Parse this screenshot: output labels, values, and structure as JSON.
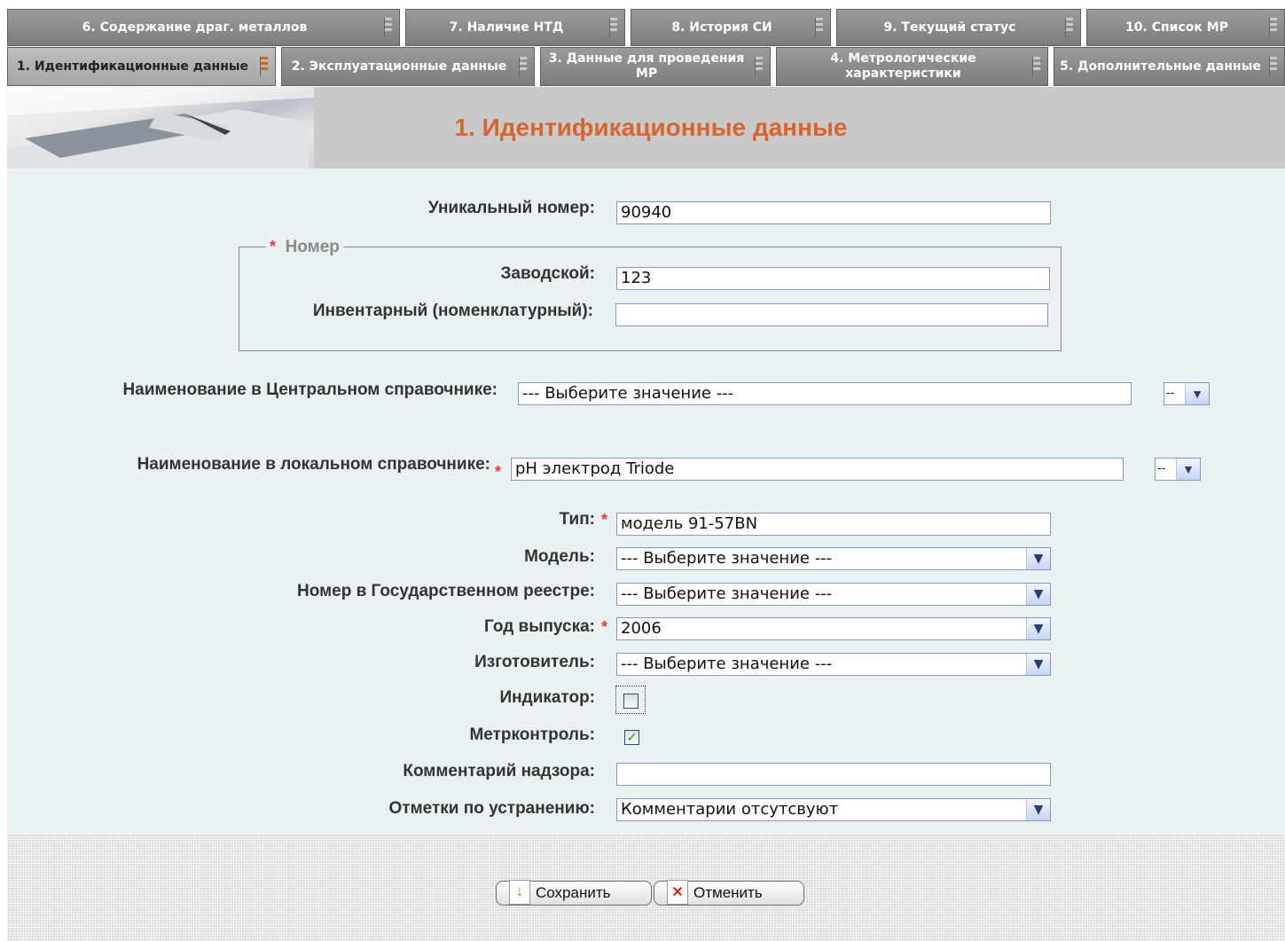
{
  "tabs": {
    "top_row": [
      {
        "label": "6. Содержание драг. металлов"
      },
      {
        "label": "7. Наличие НТД"
      },
      {
        "label": "8. История СИ"
      },
      {
        "label": "9. Текущий статус"
      },
      {
        "label": "10. Список МР"
      }
    ],
    "bottom_row": [
      {
        "label": "1. Идентификационные данные",
        "active": true
      },
      {
        "label": "2. Эксплуатационные данные"
      },
      {
        "label": "3. Данные для проведения МР"
      },
      {
        "label": "4. Метрологические характеристики"
      },
      {
        "label": "5. Дополнительные данные"
      }
    ]
  },
  "header": {
    "title": "1. Идентификационные данные"
  },
  "form": {
    "unique_number": {
      "label": "Уникальный номер:",
      "value": "90940"
    },
    "number_group": {
      "legend": "Номер",
      "required_mark": "*",
      "factory": {
        "label": "Заводской:",
        "value": "123"
      },
      "inventory": {
        "label": "Инвентарный (номенклатурный):",
        "value": ""
      }
    },
    "central_name": {
      "label": "Наименование в Центральном справочнике:",
      "value": "--- Выберите значение ---",
      "mini_value": "--"
    },
    "local_name": {
      "label": "Наименование в локальном справочнике:",
      "required_mark": "*",
      "value": "pH электрод Triode",
      "mini_value": "--"
    },
    "type": {
      "label": "Тип:",
      "required_mark": "*",
      "value": "модель 91-57BN"
    },
    "model": {
      "label": "Модель:",
      "value": "--- Выберите значение ---"
    },
    "state_registry": {
      "label": "Номер в Государственном реестре:",
      "value": "--- Выберите значение ---"
    },
    "year": {
      "label": "Год выпуска:",
      "required_mark": "*",
      "value": "2006"
    },
    "manufacturer": {
      "label": "Изготовитель:",
      "value": "--- Выберите значение ---"
    },
    "indicator": {
      "label": "Индикатор:",
      "checked": false
    },
    "metrcontrol": {
      "label": "Метрконтроль:",
      "checked": true,
      "check_glyph": "✓"
    },
    "supervision_comment": {
      "label": "Комментарий надзора:",
      "value": ""
    },
    "remedy_notes": {
      "label": "Отметки по устранению:",
      "value": "Комментарии отсутсвуют"
    }
  },
  "footer": {
    "save_label": "Сохранить",
    "cancel_label": "Отменить"
  },
  "colors": {
    "title": "#d9652e",
    "form_bg": "#e9f1f2",
    "tab_bg": "#8a8a8a",
    "required": "#e23b3b"
  }
}
